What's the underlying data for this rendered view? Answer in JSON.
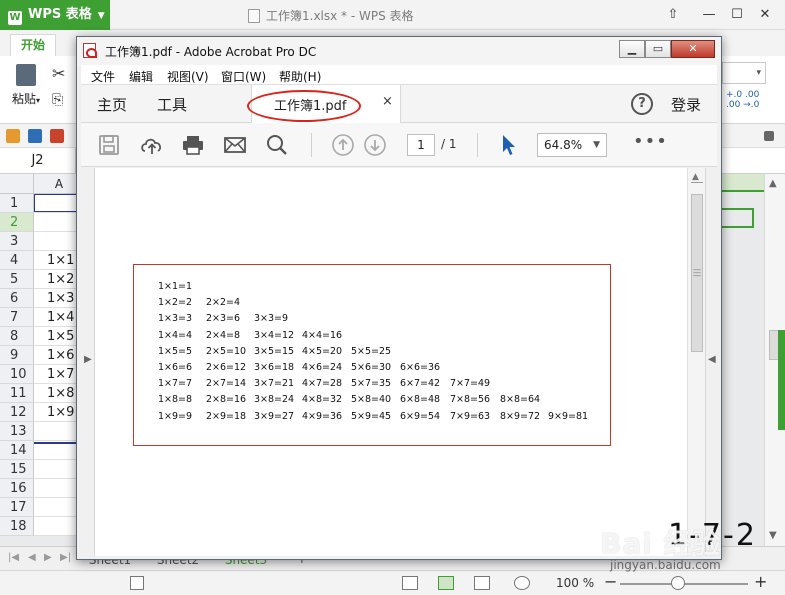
{
  "wps": {
    "app_name": "WPS 表格",
    "window_title": "工作簿1.xlsx * - WPS 表格",
    "ribbon_tab": "开始",
    "paste_label": "粘贴",
    "cell_ref": "J2",
    "column_header": "A",
    "rows": [
      {
        "num": "1",
        "a": ""
      },
      {
        "num": "2",
        "a": ""
      },
      {
        "num": "3",
        "a": ""
      },
      {
        "num": "4",
        "a": "1×1"
      },
      {
        "num": "5",
        "a": "1×2"
      },
      {
        "num": "6",
        "a": "1×3"
      },
      {
        "num": "7",
        "a": "1×4"
      },
      {
        "num": "8",
        "a": "1×5"
      },
      {
        "num": "9",
        "a": "1×6"
      },
      {
        "num": "10",
        "a": "1×7"
      },
      {
        "num": "11",
        "a": "1×8"
      },
      {
        "num": "12",
        "a": "1×9"
      },
      {
        "num": "13",
        "a": ""
      },
      {
        "num": "14",
        "a": ""
      },
      {
        "num": "15",
        "a": ""
      },
      {
        "num": "16",
        "a": ""
      },
      {
        "num": "17",
        "a": ""
      },
      {
        "num": "18",
        "a": ""
      }
    ],
    "sheets": [
      "Sheet1",
      "Sheet2",
      "Sheet3"
    ],
    "zoom_text": "100 %",
    "zoom_fraction": 0.45
  },
  "acrobat": {
    "window_title": "工作簿1.pdf - Adobe Acrobat Pro DC",
    "menu": [
      "文件",
      "编辑",
      "视图(V)",
      "窗口(W)",
      "帮助(H)"
    ],
    "nav": {
      "home": "主页",
      "tools": "工具",
      "tab_label": "工作簿1.pdf",
      "tab_close": "×",
      "help": "?",
      "login": "登录"
    },
    "toolbar": {
      "page_current": "1",
      "page_total": "/ 1",
      "zoom": "64.8%",
      "more": "•••"
    },
    "colors": {
      "highlight": "#d9241b",
      "accent": "#1f5fb3",
      "table_border": "#c0392b"
    }
  },
  "multiplication_table": [
    [
      "1×1=1"
    ],
    [
      "1×2=2",
      "2×2=4"
    ],
    [
      "1×3=3",
      "2×3=6",
      "3×3=9"
    ],
    [
      "1×4=4",
      "2×4=8",
      "3×4=12",
      "4×4=16"
    ],
    [
      "1×5=5",
      "2×5=10",
      "3×5=15",
      "4×5=20",
      "5×5=25"
    ],
    [
      "1×6=6",
      "2×6=12",
      "3×6=18",
      "4×6=24",
      "5×6=30",
      "6×6=36"
    ],
    [
      "1×7=7",
      "2×7=14",
      "3×7=21",
      "4×7=28",
      "5×7=35",
      "6×7=42",
      "7×7=49"
    ],
    [
      "1×8=8",
      "2×8=16",
      "3×8=24",
      "4×8=32",
      "5×8=40",
      "6×8=48",
      "7×8=56",
      "8×8=64"
    ],
    [
      "1×9=9",
      "2×9=18",
      "3×9=27",
      "4×9=36",
      "5×9=45",
      "6×9=54",
      "7×9=63",
      "8×9=72",
      "9×9=81"
    ]
  ],
  "watermark": {
    "main": "Bai 经验",
    "sub": "jingyan.baidu.com"
  },
  "overlay_digits": "1-7-2"
}
